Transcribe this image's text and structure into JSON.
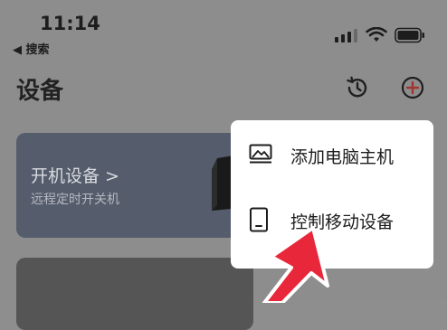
{
  "status_bar": {
    "time": "11:14",
    "back_label": "◀ 搜索"
  },
  "header": {
    "title": "设备"
  },
  "device_card": {
    "title": "开机设备 >",
    "subtitle": "远程定时开关机"
  },
  "menu": {
    "items": [
      {
        "label": "添加电脑主机",
        "icon": "picture-icon"
      },
      {
        "label": "控制移动设备",
        "icon": "phone-icon"
      }
    ]
  },
  "colors": {
    "accent": "#e8443a",
    "arrow": "#e8283a",
    "overlay": "#8d8d8d",
    "menu_bg": "#ffffff"
  }
}
